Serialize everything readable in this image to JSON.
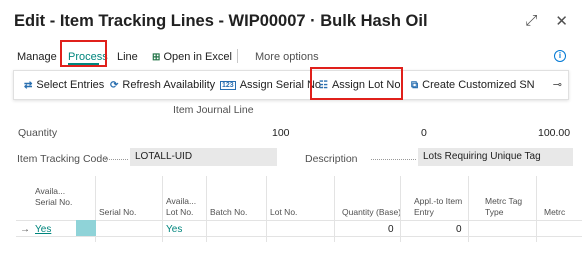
{
  "window": {
    "title": "Edit - Item Tracking Lines - WIP00007 · Bulk Hash Oil",
    "expand_icon": "expand-icon",
    "close_icon": "close-icon"
  },
  "tabs": {
    "manage": "Manage",
    "process": "Process",
    "line": "Line",
    "open_in_excel": "Open in Excel",
    "more_options": "More options"
  },
  "ribbon": {
    "select_entries": "Select Entries",
    "refresh_availability": "Refresh Availability",
    "assign_serial_no": "Assign Serial No.",
    "assign_lot_no": "Assign Lot No.",
    "create_customized_sn": "Create Customized SN"
  },
  "header": {
    "section_label": "Item Journal Line",
    "quantity_label": "Quantity",
    "quantity_value": "100",
    "qty_col2": "0",
    "qty_col3": "100.00",
    "item_tracking_code_label": "Item Tracking Code",
    "item_tracking_code_value": "LOTALL-UID",
    "description_label": "Description",
    "description_value": "Lots Requiring Unique Tag"
  },
  "grid": {
    "columns": [
      "Availa... Serial No.",
      "Serial No.",
      "Availa... Lot No.",
      "Batch No.",
      "Lot No.",
      "Quantity (Base)",
      "Appl.-to Item Entry",
      "Metrc Tag Type",
      "Metrc"
    ],
    "row": {
      "arrow": "→",
      "avail_serial": "Yes",
      "serial_no": "",
      "avail_lot": "Yes",
      "batch_no": "",
      "lot_no": "",
      "quantity_base": "0",
      "appl_to_item_entry": "0",
      "metrc_tag_type": ""
    }
  },
  "colors": {
    "accent": "#00857d",
    "highlight_box": "#e0201b",
    "selected_cell": "#8fd3d8"
  }
}
